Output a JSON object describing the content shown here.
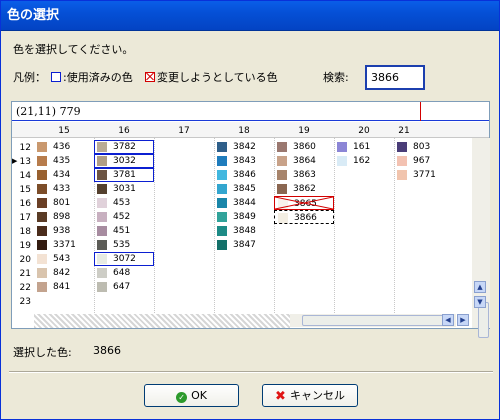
{
  "window": {
    "title": "色の選択"
  },
  "prompt": "色を選択してください。",
  "legend": {
    "label": "凡例：",
    "used": ":使用済みの色",
    "changing": "変更しようとしている色",
    "search_label": "検索:"
  },
  "search": {
    "value": "3866"
  },
  "grid": {
    "coord_text": "(21,11) 779",
    "columns": [
      "15",
      "16",
      "17",
      "18",
      "19",
      "20",
      "21"
    ],
    "rows": [
      "12",
      "13",
      "14",
      "15",
      "16",
      "17",
      "18",
      "19",
      "20",
      "21",
      "22",
      "23"
    ],
    "cells": [
      {
        "row": 0,
        "col": 0,
        "num": "436",
        "color": "#c9986e"
      },
      {
        "row": 0,
        "col": 1,
        "num": "3782",
        "color": "#b9ab96",
        "state": "used"
      },
      {
        "row": 0,
        "col": 3,
        "num": "3842",
        "color": "#2f5f8a"
      },
      {
        "row": 0,
        "col": 4,
        "num": "3860",
        "color": "#9a7870"
      },
      {
        "row": 0,
        "col": 5,
        "num": "161",
        "color": "#8c86d6"
      },
      {
        "row": 0,
        "col": 6,
        "num": "803",
        "color": "#4a3d78"
      },
      {
        "row": 1,
        "col": 0,
        "num": "435",
        "color": "#b77c4c"
      },
      {
        "row": 1,
        "col": 1,
        "num": "3032",
        "color": "#b09e86",
        "state": "used"
      },
      {
        "row": 1,
        "col": 3,
        "num": "3843",
        "color": "#1f7cbc"
      },
      {
        "row": 1,
        "col": 4,
        "num": "3864",
        "color": "#c8a289"
      },
      {
        "row": 1,
        "col": 5,
        "num": "162",
        "color": "#d9ebf6"
      },
      {
        "row": 1,
        "col": 6,
        "num": "967",
        "color": "#f3c2b2"
      },
      {
        "row": 2,
        "col": 0,
        "num": "434",
        "color": "#98602f"
      },
      {
        "row": 2,
        "col": 1,
        "num": "3781",
        "color": "#6c5443",
        "state": "used"
      },
      {
        "row": 2,
        "col": 3,
        "num": "3846",
        "color": "#41b7df"
      },
      {
        "row": 2,
        "col": 4,
        "num": "3863",
        "color": "#a7846b"
      },
      {
        "row": 2,
        "col": 6,
        "num": "3771",
        "color": "#f1c4ad"
      },
      {
        "row": 3,
        "col": 0,
        "num": "433",
        "color": "#7c4d29"
      },
      {
        "row": 3,
        "col": 1,
        "num": "3031",
        "color": "#54402e"
      },
      {
        "row": 3,
        "col": 3,
        "num": "3845",
        "color": "#33a6cf"
      },
      {
        "row": 3,
        "col": 4,
        "num": "3862",
        "color": "#8a6651"
      },
      {
        "row": 4,
        "col": 0,
        "num": "801",
        "color": "#6a3f25"
      },
      {
        "row": 4,
        "col": 1,
        "num": "453",
        "color": "#e0d1da"
      },
      {
        "row": 4,
        "col": 3,
        "num": "3844",
        "color": "#1a86a9"
      },
      {
        "row": 4,
        "col": 4,
        "num": "3865",
        "color": "#f7f3ec",
        "state": "changing"
      },
      {
        "row": 5,
        "col": 0,
        "num": "898",
        "color": "#5a3b25"
      },
      {
        "row": 5,
        "col": 1,
        "num": "452",
        "color": "#c8b0c0"
      },
      {
        "row": 5,
        "col": 3,
        "num": "3849",
        "color": "#31a39a"
      },
      {
        "row": 5,
        "col": 4,
        "num": "3866",
        "color": "#f3eee3",
        "state": "dashed"
      },
      {
        "row": 6,
        "col": 0,
        "num": "938",
        "color": "#4a2c1b"
      },
      {
        "row": 6,
        "col": 1,
        "num": "451",
        "color": "#a78ca0"
      },
      {
        "row": 6,
        "col": 3,
        "num": "3848",
        "color": "#1d8b86"
      },
      {
        "row": 7,
        "col": 0,
        "num": "3371",
        "color": "#331b10"
      },
      {
        "row": 7,
        "col": 1,
        "num": "535",
        "color": "#5c5c57"
      },
      {
        "row": 7,
        "col": 3,
        "num": "3847",
        "color": "#137069"
      },
      {
        "row": 8,
        "col": 0,
        "num": "543",
        "color": "#f3e2d3"
      },
      {
        "row": 8,
        "col": 1,
        "num": "3072",
        "color": "#e7ebe3",
        "state": "used"
      },
      {
        "row": 9,
        "col": 0,
        "num": "842",
        "color": "#d9c4ad"
      },
      {
        "row": 9,
        "col": 1,
        "num": "648",
        "color": "#cdcdc6"
      },
      {
        "row": 10,
        "col": 0,
        "num": "841",
        "color": "#c3a38e"
      },
      {
        "row": 10,
        "col": 1,
        "num": "647",
        "color": "#bdbcb1"
      }
    ]
  },
  "selected": {
    "label": "選択した色:",
    "value": "3866"
  },
  "buttons": {
    "ok": "OK",
    "cancel": "キャンセル"
  },
  "icons": {
    "ok": "check-circle-icon",
    "cancel": "x-icon"
  }
}
